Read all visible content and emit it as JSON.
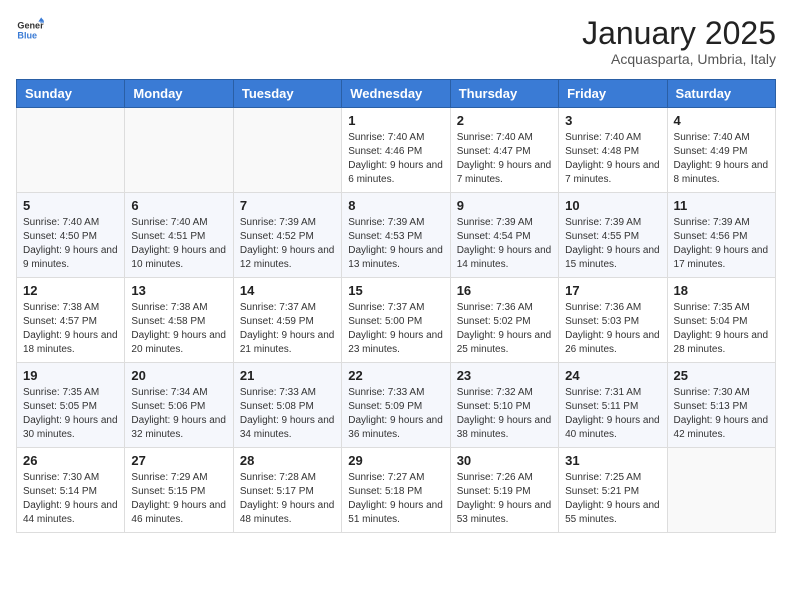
{
  "logo": {
    "general": "General",
    "blue": "Blue"
  },
  "title": "January 2025",
  "subtitle": "Acquasparta, Umbria, Italy",
  "weekdays": [
    "Sunday",
    "Monday",
    "Tuesday",
    "Wednesday",
    "Thursday",
    "Friday",
    "Saturday"
  ],
  "weeks": [
    [
      {
        "day": "",
        "info": ""
      },
      {
        "day": "",
        "info": ""
      },
      {
        "day": "",
        "info": ""
      },
      {
        "day": "1",
        "info": "Sunrise: 7:40 AM\nSunset: 4:46 PM\nDaylight: 9 hours and 6 minutes."
      },
      {
        "day": "2",
        "info": "Sunrise: 7:40 AM\nSunset: 4:47 PM\nDaylight: 9 hours and 7 minutes."
      },
      {
        "day": "3",
        "info": "Sunrise: 7:40 AM\nSunset: 4:48 PM\nDaylight: 9 hours and 7 minutes."
      },
      {
        "day": "4",
        "info": "Sunrise: 7:40 AM\nSunset: 4:49 PM\nDaylight: 9 hours and 8 minutes."
      }
    ],
    [
      {
        "day": "5",
        "info": "Sunrise: 7:40 AM\nSunset: 4:50 PM\nDaylight: 9 hours and 9 minutes."
      },
      {
        "day": "6",
        "info": "Sunrise: 7:40 AM\nSunset: 4:51 PM\nDaylight: 9 hours and 10 minutes."
      },
      {
        "day": "7",
        "info": "Sunrise: 7:39 AM\nSunset: 4:52 PM\nDaylight: 9 hours and 12 minutes."
      },
      {
        "day": "8",
        "info": "Sunrise: 7:39 AM\nSunset: 4:53 PM\nDaylight: 9 hours and 13 minutes."
      },
      {
        "day": "9",
        "info": "Sunrise: 7:39 AM\nSunset: 4:54 PM\nDaylight: 9 hours and 14 minutes."
      },
      {
        "day": "10",
        "info": "Sunrise: 7:39 AM\nSunset: 4:55 PM\nDaylight: 9 hours and 15 minutes."
      },
      {
        "day": "11",
        "info": "Sunrise: 7:39 AM\nSunset: 4:56 PM\nDaylight: 9 hours and 17 minutes."
      }
    ],
    [
      {
        "day": "12",
        "info": "Sunrise: 7:38 AM\nSunset: 4:57 PM\nDaylight: 9 hours and 18 minutes."
      },
      {
        "day": "13",
        "info": "Sunrise: 7:38 AM\nSunset: 4:58 PM\nDaylight: 9 hours and 20 minutes."
      },
      {
        "day": "14",
        "info": "Sunrise: 7:37 AM\nSunset: 4:59 PM\nDaylight: 9 hours and 21 minutes."
      },
      {
        "day": "15",
        "info": "Sunrise: 7:37 AM\nSunset: 5:00 PM\nDaylight: 9 hours and 23 minutes."
      },
      {
        "day": "16",
        "info": "Sunrise: 7:36 AM\nSunset: 5:02 PM\nDaylight: 9 hours and 25 minutes."
      },
      {
        "day": "17",
        "info": "Sunrise: 7:36 AM\nSunset: 5:03 PM\nDaylight: 9 hours and 26 minutes."
      },
      {
        "day": "18",
        "info": "Sunrise: 7:35 AM\nSunset: 5:04 PM\nDaylight: 9 hours and 28 minutes."
      }
    ],
    [
      {
        "day": "19",
        "info": "Sunrise: 7:35 AM\nSunset: 5:05 PM\nDaylight: 9 hours and 30 minutes."
      },
      {
        "day": "20",
        "info": "Sunrise: 7:34 AM\nSunset: 5:06 PM\nDaylight: 9 hours and 32 minutes."
      },
      {
        "day": "21",
        "info": "Sunrise: 7:33 AM\nSunset: 5:08 PM\nDaylight: 9 hours and 34 minutes."
      },
      {
        "day": "22",
        "info": "Sunrise: 7:33 AM\nSunset: 5:09 PM\nDaylight: 9 hours and 36 minutes."
      },
      {
        "day": "23",
        "info": "Sunrise: 7:32 AM\nSunset: 5:10 PM\nDaylight: 9 hours and 38 minutes."
      },
      {
        "day": "24",
        "info": "Sunrise: 7:31 AM\nSunset: 5:11 PM\nDaylight: 9 hours and 40 minutes."
      },
      {
        "day": "25",
        "info": "Sunrise: 7:30 AM\nSunset: 5:13 PM\nDaylight: 9 hours and 42 minutes."
      }
    ],
    [
      {
        "day": "26",
        "info": "Sunrise: 7:30 AM\nSunset: 5:14 PM\nDaylight: 9 hours and 44 minutes."
      },
      {
        "day": "27",
        "info": "Sunrise: 7:29 AM\nSunset: 5:15 PM\nDaylight: 9 hours and 46 minutes."
      },
      {
        "day": "28",
        "info": "Sunrise: 7:28 AM\nSunset: 5:17 PM\nDaylight: 9 hours and 48 minutes."
      },
      {
        "day": "29",
        "info": "Sunrise: 7:27 AM\nSunset: 5:18 PM\nDaylight: 9 hours and 51 minutes."
      },
      {
        "day": "30",
        "info": "Sunrise: 7:26 AM\nSunset: 5:19 PM\nDaylight: 9 hours and 53 minutes."
      },
      {
        "day": "31",
        "info": "Sunrise: 7:25 AM\nSunset: 5:21 PM\nDaylight: 9 hours and 55 minutes."
      },
      {
        "day": "",
        "info": ""
      }
    ]
  ]
}
